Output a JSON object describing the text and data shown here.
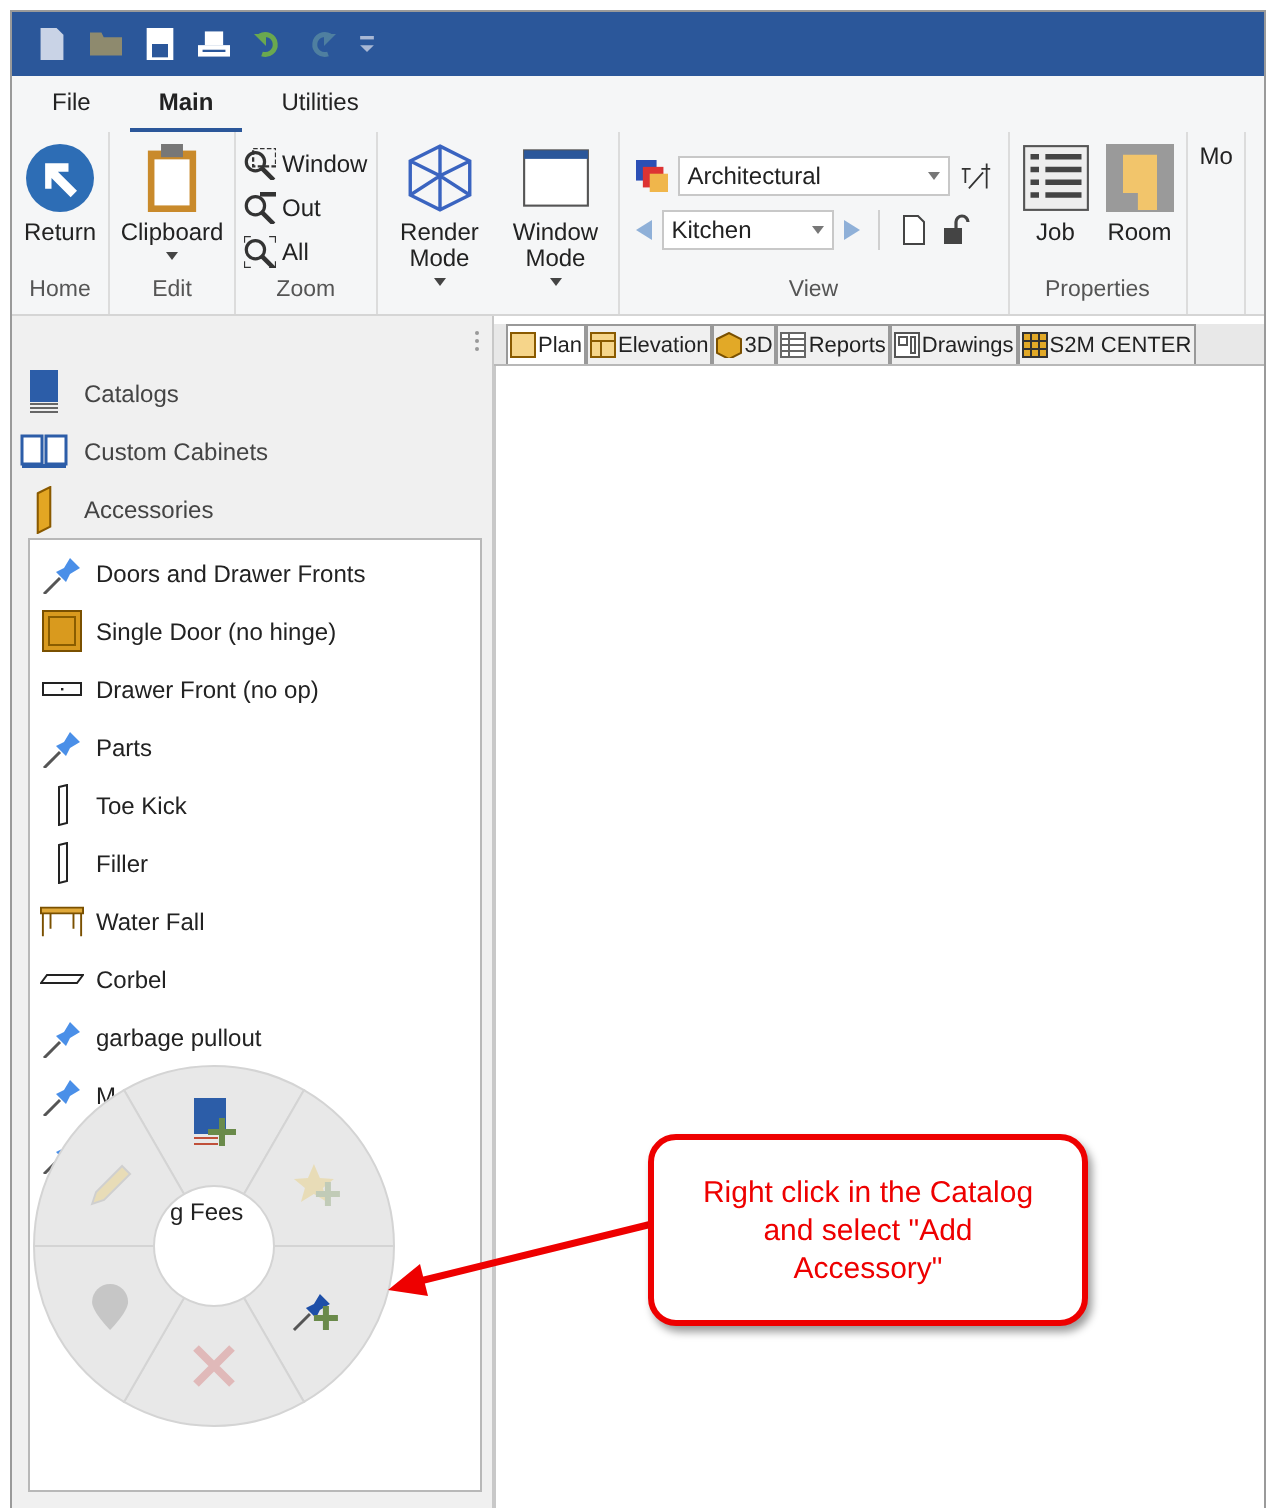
{
  "menu_tabs": [
    {
      "label": "File",
      "selected": false
    },
    {
      "label": "Main",
      "selected": true
    },
    {
      "label": "Utilities",
      "selected": false
    }
  ],
  "ribbon": {
    "groups": [
      {
        "label": "Home",
        "kind": "large",
        "buttons": [
          {
            "label": "Return",
            "kind": "return",
            "dropdown": false
          }
        ]
      },
      {
        "label": "Edit",
        "kind": "large",
        "buttons": [
          {
            "label": "Clipboard",
            "kind": "clipboard",
            "dropdown": true
          }
        ]
      },
      {
        "label": "Zoom",
        "kind": "small",
        "buttons": [
          {
            "label": "Window",
            "kind": "zoom-window"
          },
          {
            "label": "Out",
            "kind": "zoom-out"
          },
          {
            "label": "All",
            "kind": "zoom-all"
          }
        ]
      },
      {
        "kind": "large",
        "buttons": [
          {
            "label": "Render Mode",
            "kind": "cube",
            "dropdown": true
          },
          {
            "label": "Window Mode",
            "kind": "window",
            "dropdown": true
          }
        ]
      },
      {
        "label": "View",
        "kind": "view",
        "combos": [
          {
            "value": "Architectural"
          },
          {
            "value": "Kitchen"
          }
        ]
      },
      {
        "label": "Properties",
        "kind": "large",
        "buttons": [
          {
            "label": "Job",
            "kind": "job",
            "dropdown": false
          },
          {
            "label": "Room",
            "kind": "room",
            "dropdown": false
          }
        ]
      },
      {
        "kind": "large",
        "buttons": [
          {
            "label": "Mo",
            "kind": "plain",
            "dropdown": false
          }
        ]
      }
    ]
  },
  "document_tabs": [
    {
      "label": "Plan",
      "kind": "plan",
      "selected": true
    },
    {
      "label": "Elevation",
      "kind": "elevation",
      "selected": false
    },
    {
      "label": "3D",
      "kind": "box",
      "selected": false
    },
    {
      "label": "Reports",
      "kind": "report",
      "selected": false
    },
    {
      "label": "Drawings",
      "kind": "drawing",
      "selected": false
    },
    {
      "label": "S2M CENTER",
      "kind": "s2m",
      "selected": false
    }
  ],
  "catalog_categories": [
    {
      "label": "Catalogs",
      "kind": "book"
    },
    {
      "label": "Custom Cabinets",
      "kind": "open-book"
    },
    {
      "label": "Accessories",
      "kind": "door-edge"
    }
  ],
  "catalog_items": [
    {
      "kind": "pin",
      "label": "Doors and Drawer Fronts"
    },
    {
      "kind": "door",
      "label": "Single Door (no hinge)"
    },
    {
      "kind": "drawer",
      "label": "Drawer Front (no op)"
    },
    {
      "kind": "pin",
      "label": "Parts"
    },
    {
      "kind": "panel",
      "label": "Toe Kick"
    },
    {
      "kind": "panel",
      "label": "Filler"
    },
    {
      "kind": "table",
      "label": "Water Fall"
    },
    {
      "kind": "slab",
      "label": "Corbel"
    },
    {
      "kind": "pin",
      "label": "garbage pullout"
    },
    {
      "kind": "pin",
      "label": "M"
    },
    {
      "kind": "pin"
    },
    {
      "kind": "partial",
      "label": "g Fees"
    }
  ],
  "radial_menu": [
    {
      "kind": "book-plus",
      "disabled": false
    },
    {
      "kind": "star-plus",
      "disabled": true
    },
    {
      "kind": "pin-plus",
      "disabled": false
    },
    {
      "kind": "cross",
      "disabled": true
    },
    {
      "kind": "marker",
      "disabled": true
    },
    {
      "kind": "pencil",
      "disabled": true
    }
  ],
  "callout": {
    "text": "Right click in the Catalog and select \"Add Accessory\""
  }
}
